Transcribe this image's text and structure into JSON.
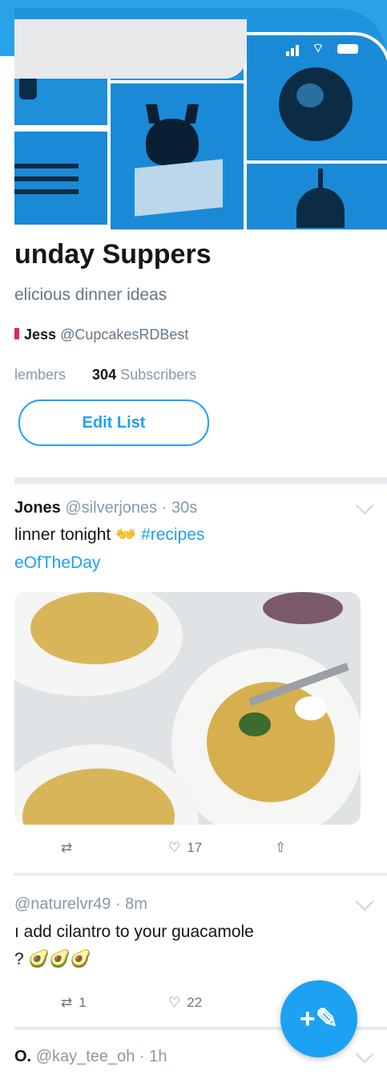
{
  "status_bar": {
    "signal": "ıll",
    "wifi": "wifi"
  },
  "list": {
    "title": "unday Suppers",
    "description": "elicious dinner ideas",
    "owner_name": "Jess",
    "owner_handle": "@CupcakesRDBest",
    "members_label": "lembers",
    "subscribers_count": "304",
    "subscribers_label": "Subscribers",
    "edit_button": "Edit List"
  },
  "tweets": [
    {
      "name": "Jones",
      "handle": "@silverjones",
      "time": "· 30s",
      "text": "linner tonight 👐 ",
      "hashtag": "#recipes",
      "text_line2": "eOfTheDay",
      "retweet_count": "",
      "like_count": "17"
    },
    {
      "handle": "@naturelvr49",
      "time": "· 8m",
      "text": "ı add cilantro to your guacamole",
      "text_line2": "? 🥑🥑🥑",
      "retweet_count": "1",
      "like_count": "22"
    },
    {
      "name": "O.",
      "handle": "@kay_tee_oh",
      "time": "· 1h"
    }
  ],
  "fab_icon": "+✎",
  "colors": {
    "brand": "#1da1f2",
    "banner": "#1e94e0"
  }
}
